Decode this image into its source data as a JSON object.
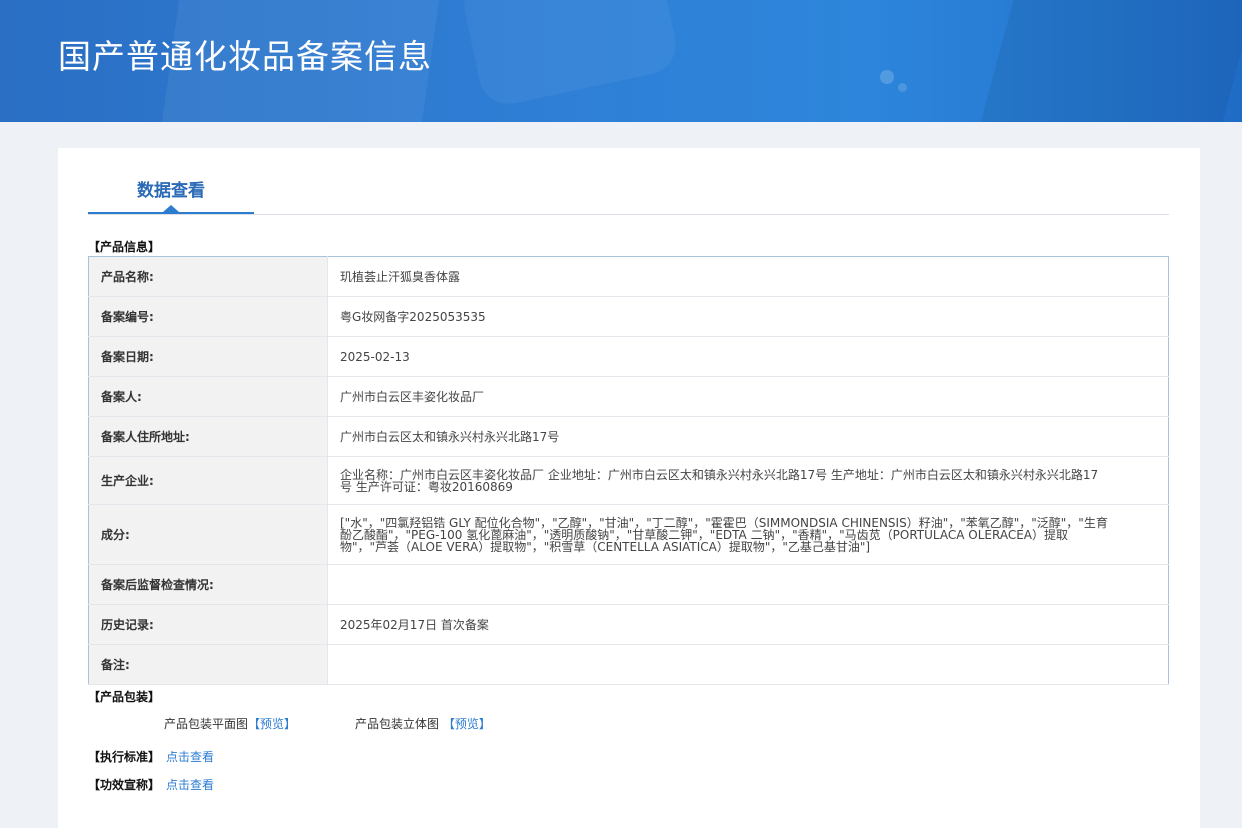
{
  "header": {
    "title": "国产普通化妆品备案信息"
  },
  "tab": {
    "label": "数据查看"
  },
  "sections": {
    "product_info": "【产品信息】",
    "packaging": "【产品包装】",
    "standard": "【执行标准】",
    "efficacy": "【功效宣称】"
  },
  "rows": [
    {
      "label": "产品名称:",
      "value": "玑植荟止汗狐臭香体露"
    },
    {
      "label": "备案编号:",
      "value": "粤G妆网备字2025053535"
    },
    {
      "label": "备案日期:",
      "value": "2025-02-13"
    },
    {
      "label": "备案人:",
      "value": "广州市白云区丰姿化妆品厂"
    },
    {
      "label": "备案人住所地址:",
      "value": "广州市白云区太和镇永兴村永兴北路17号"
    },
    {
      "label": "生产企业:",
      "value": "企业名称：广州市白云区丰姿化妆品厂 企业地址：广州市白云区太和镇永兴村永兴北路17号 生产地址：广州市白云区太和镇永兴村永兴北路17号 生产许可证：粤妆20160869"
    },
    {
      "label": "成分:",
      "value": "[\"水\"，\"四氯羟铝锆 GLY 配位化合物\"，\"乙醇\"，\"甘油\"，\"丁二醇\"，\"霍霍巴（SIMMONDSIA CHINENSIS）籽油\"，\"苯氧乙醇\"，\"泛醇\"，\"生育酚乙酸酯\"，\"PEG-100 氢化蓖麻油\"，\"透明质酸钠\"，\"甘草酸二钾\"，\"EDTA 二钠\"，\"香精\"，\"马齿苋（PORTULACA OLERACEA）提取物\"，\"芦荟（ALOE VERA）提取物\"，\"积雪草（CENTELLA ASIATICA）提取物\"，\"乙基己基甘油\"]"
    },
    {
      "label": "备案后监督检查情况:",
      "value": ""
    },
    {
      "label": "历史记录:",
      "value": "2025年02月17日 首次备案"
    },
    {
      "label": "备注:",
      "value": ""
    }
  ],
  "packaging": {
    "flat_label": "产品包装平面图",
    "flat_link": "【预览】",
    "solid_label": "产品包装立体图",
    "solid_link": "【预览】"
  },
  "standard_link": "点击查看",
  "efficacy_link": "点击查看"
}
